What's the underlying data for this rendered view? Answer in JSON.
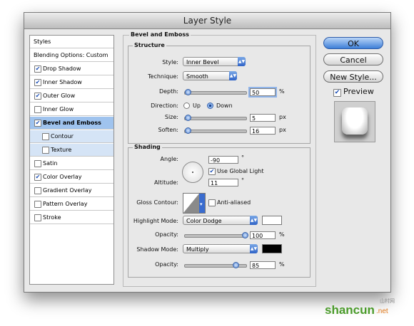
{
  "window": {
    "title": "Layer Style"
  },
  "left_list": {
    "items": [
      {
        "label": "Styles",
        "checkbox": false,
        "checked": false
      },
      {
        "label": "Blending Options: Custom",
        "checkbox": false,
        "checked": false
      },
      {
        "label": "Drop Shadow",
        "checkbox": true,
        "checked": true
      },
      {
        "label": "Inner Shadow",
        "checkbox": true,
        "checked": true
      },
      {
        "label": "Outer Glow",
        "checkbox": true,
        "checked": true
      },
      {
        "label": "Inner Glow",
        "checkbox": true,
        "checked": false
      },
      {
        "label": "Bevel and Emboss",
        "checkbox": true,
        "checked": true
      },
      {
        "label": "Contour",
        "checkbox": true,
        "checked": false
      },
      {
        "label": "Texture",
        "checkbox": true,
        "checked": false
      },
      {
        "label": "Satin",
        "checkbox": true,
        "checked": false
      },
      {
        "label": "Color Overlay",
        "checkbox": true,
        "checked": true
      },
      {
        "label": "Gradient Overlay",
        "checkbox": true,
        "checked": false
      },
      {
        "label": "Pattern Overlay",
        "checkbox": true,
        "checked": false
      },
      {
        "label": "Stroke",
        "checkbox": true,
        "checked": false
      }
    ]
  },
  "panel": {
    "title": "Bevel and Emboss",
    "structure": {
      "title": "Structure",
      "style_label": "Style:",
      "style_value": "Inner Bevel",
      "technique_label": "Technique:",
      "technique_value": "Smooth",
      "depth_label": "Depth:",
      "depth_value": "50",
      "depth_unit": "%",
      "depth_level": 0.05,
      "direction_label": "Direction:",
      "direction_up": "Up",
      "direction_down": "Down",
      "size_label": "Size:",
      "size_value": "5",
      "size_unit": "px",
      "soften_label": "Soften:",
      "soften_value": "16",
      "soften_unit": "px"
    },
    "shading": {
      "title": "Shading",
      "angle_label": "Angle:",
      "angle_value": "-90",
      "degree_sign": "°",
      "use_global_light": "Use Global Light",
      "altitude_label": "Altitude:",
      "altitude_value": "11",
      "gloss_contour_label": "Gloss Contour:",
      "anti_aliased": "Anti-aliased",
      "highlight_mode_label": "Highlight Mode:",
      "highlight_mode_value": "Color Dodge",
      "highlight_color": "#ffffff",
      "highlight_opacity_label": "Opacity:",
      "highlight_opacity_value": "100",
      "highlight_opacity_unit": "%",
      "shadow_mode_label": "Shadow Mode:",
      "shadow_mode_value": "Multiply",
      "shadow_color": "#000000",
      "shadow_opacity_label": "Opacity:",
      "shadow_opacity_value": "85",
      "shadow_opacity_unit": "%"
    }
  },
  "buttons": {
    "ok": "OK",
    "cancel": "Cancel",
    "new_style": "New Style...",
    "preview": "Preview"
  },
  "watermark": {
    "brand": "shancun",
    "tld": ".net",
    "cn": "山村网"
  }
}
